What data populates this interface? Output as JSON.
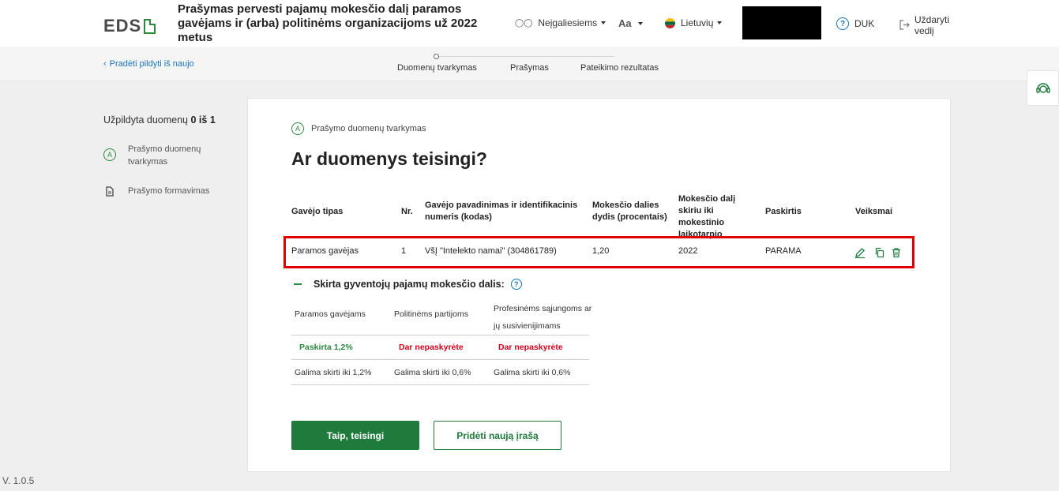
{
  "header": {
    "logo": "EDS",
    "title": "Prašymas pervesti pajamų mokesčio dalį paramos gavėjams ir (arba) politinėms organizacijoms už 2022 metus",
    "accessibility": "Neįgaliesiems",
    "font_size": "Aa",
    "language": "Lietuvių",
    "faq": "DUK",
    "close": "Uždaryti vedlį"
  },
  "subbar": {
    "back": "Pradėti pildyti iš naujo",
    "steps": [
      "Duomenų tvarkymas",
      "Prašymas",
      "Pateikimo rezultatas"
    ]
  },
  "sidebar": {
    "progress_label": "Užpildyta duomenų",
    "progress_value": "0 iš 1",
    "items": [
      {
        "icon_letter": "A",
        "label": "Prašymo duomenų tvarkymas"
      },
      {
        "label": "Prašymo formavimas"
      }
    ]
  },
  "version": "V. 1.0.5",
  "main": {
    "crumb_letter": "A",
    "crumb": "Prašymo duomenų tvarkymas",
    "heading": "Ar duomenys teisingi?",
    "table": {
      "columns": [
        "Gavėjo tipas",
        "Nr.",
        "Gavėjo pavadinimas ir identifikacinis numeris (kodas)",
        "Mokesčio dalies dydis (procentais)",
        "Mokesčio dalį skiriu iki mokestinio laikotarpio",
        "Paskirtis",
        "Veiksmai"
      ],
      "rows": [
        [
          "Paramos gavėjas",
          "1",
          "VšĮ \"Intelekto namai\" (304861789)",
          "1,20",
          "2022",
          "PARAMA"
        ]
      ]
    },
    "allocation": {
      "title": "Skirta gyventojų pajamų mokesčio dalis:",
      "help": "?",
      "columns": [
        "Paramos gavėjams",
        "Politinėms partijoms",
        "Profesinėms sąjungoms ar jų susivienijimams"
      ],
      "status": [
        "Paskirta 1,2%",
        "Dar nepaskyrėte",
        "Dar nepaskyrėte"
      ],
      "limits": [
        "Galima skirti iki 1,2%",
        "Galima skirti iki 0,6%",
        "Galima skirti iki 0,6%"
      ]
    },
    "confirm_button": "Taip, teisingi",
    "add_button": "Pridėti naują įrašą"
  },
  "colors": {
    "primary_green": "#1e7b3b",
    "link_blue": "#1a73b8",
    "alert_red": "#d0021b",
    "highlight_border": "#e00000"
  }
}
